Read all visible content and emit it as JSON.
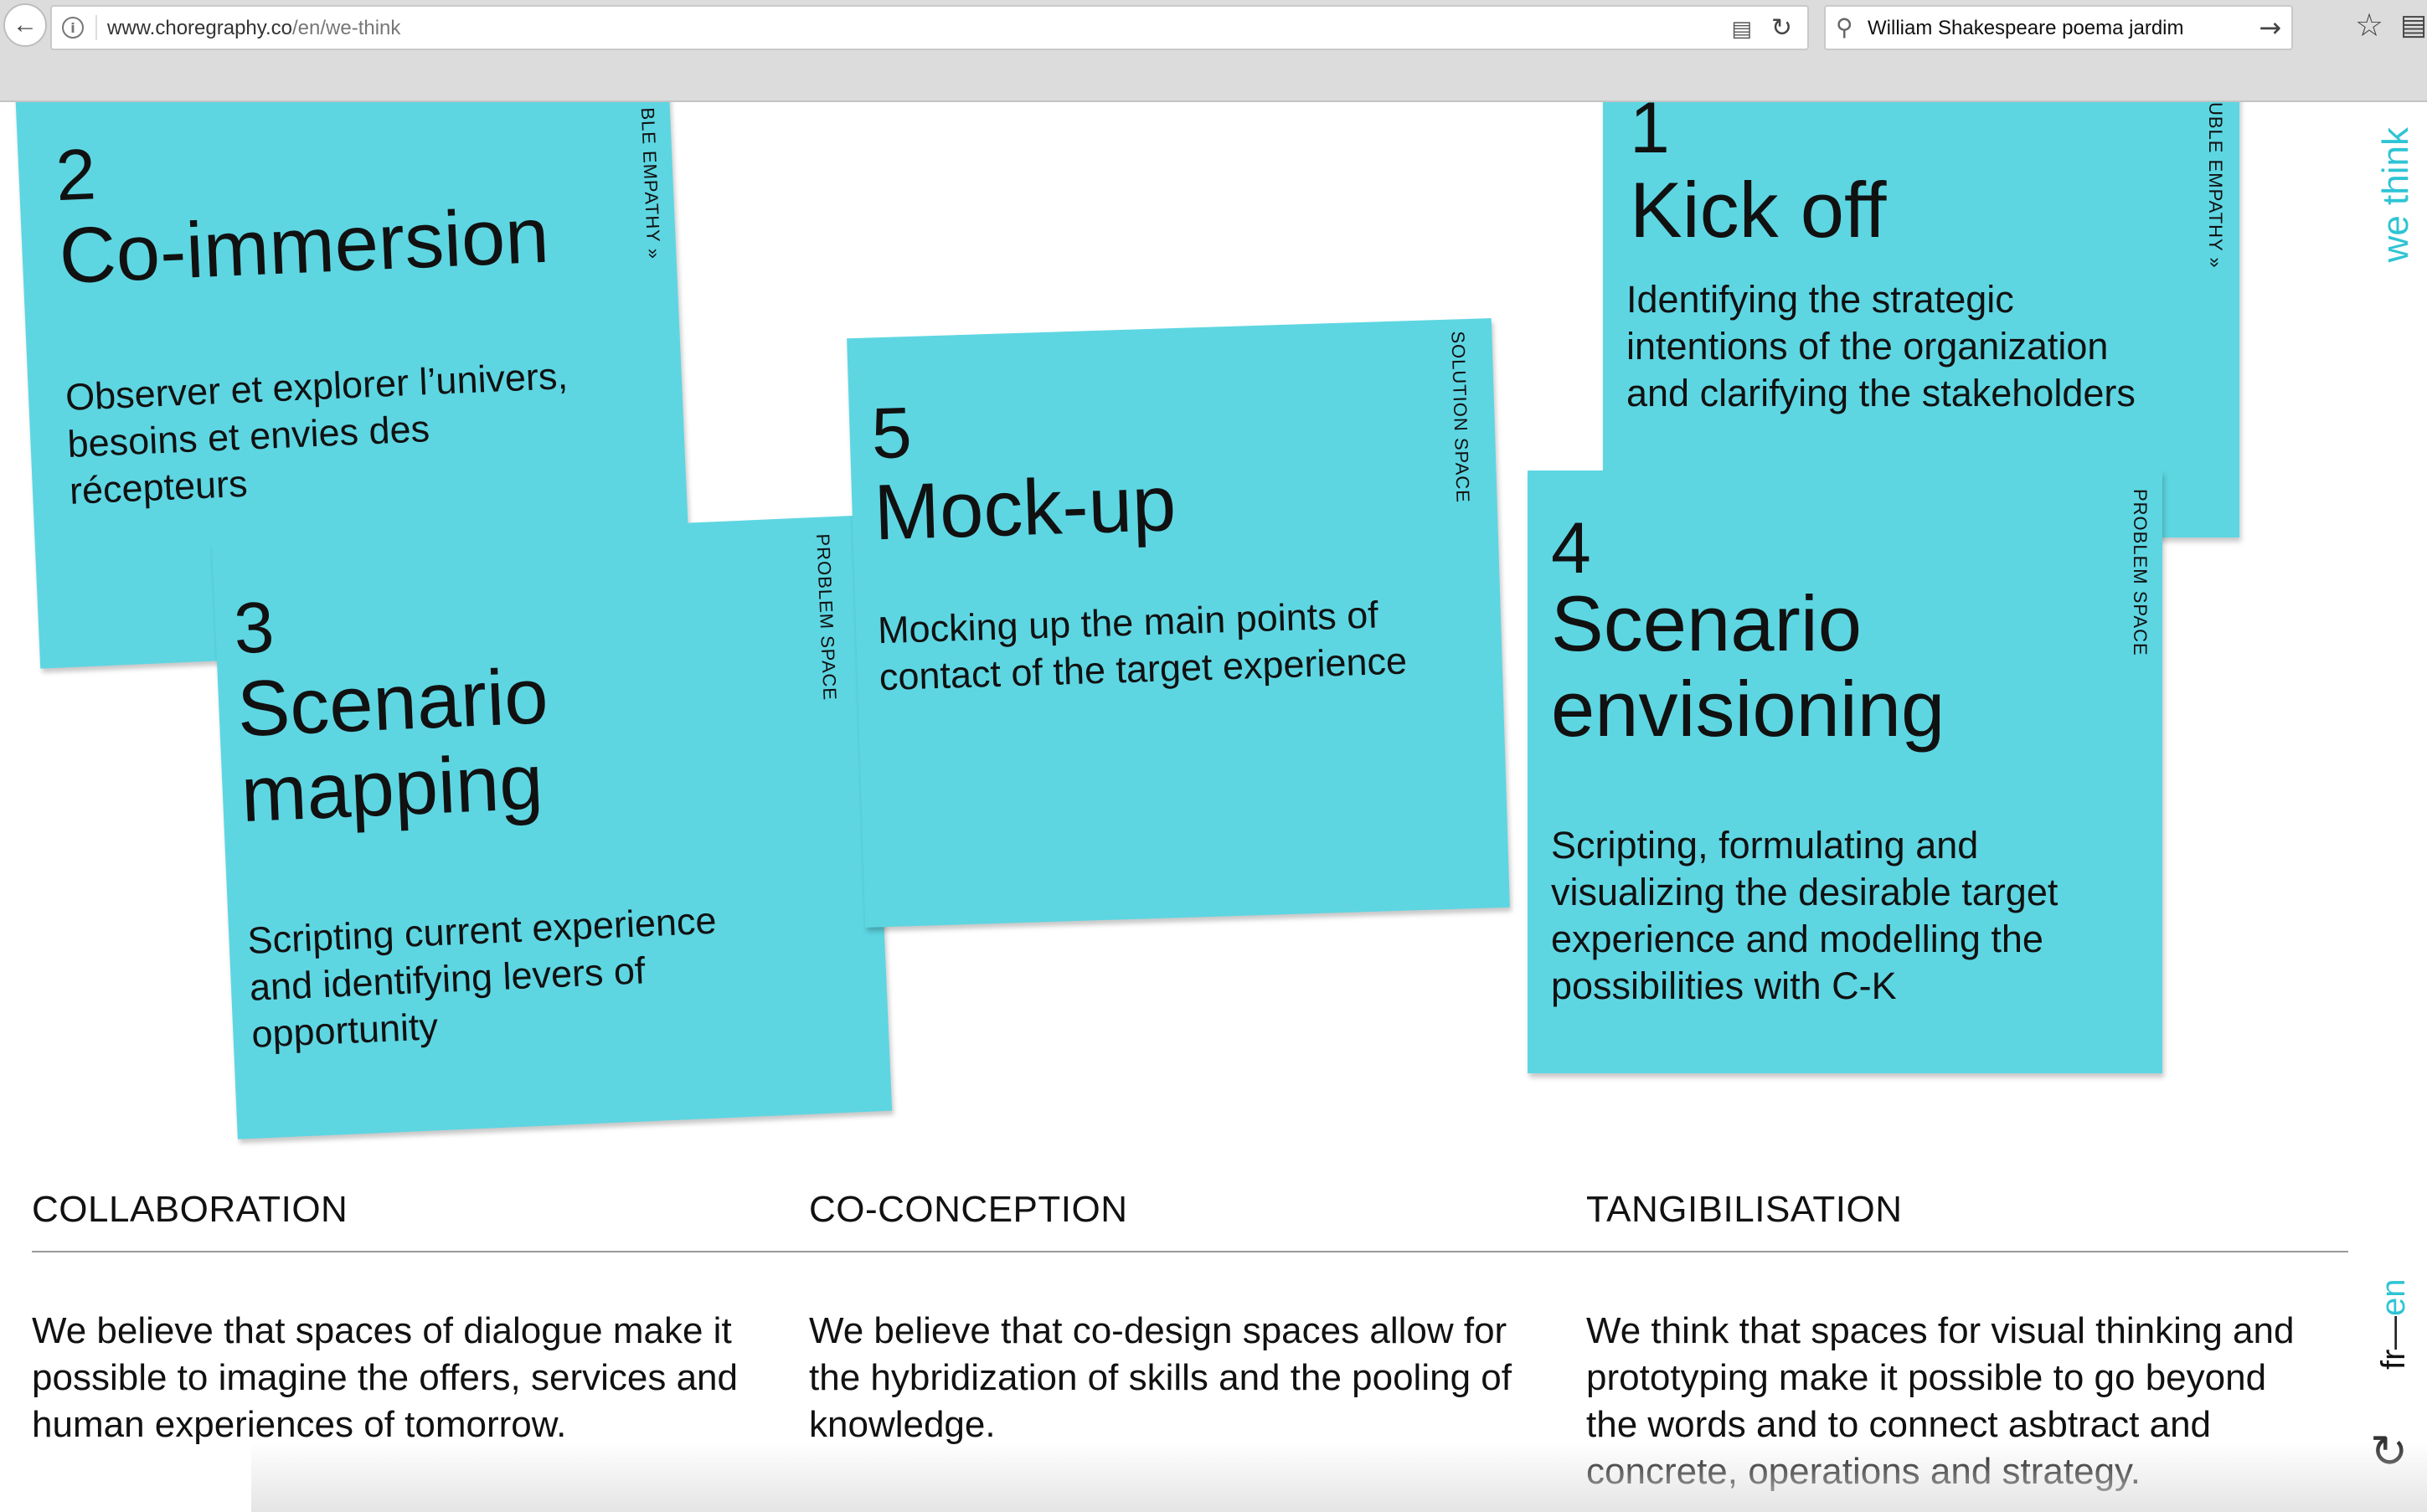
{
  "browser": {
    "url_domain": "www.choregraphy.co",
    "url_path": "/en/we-think",
    "search_query": "William Shakespeare poema jardim"
  },
  "icons": {
    "back": "back-arrow-icon",
    "info": "info-icon",
    "reader": "reader-view-icon",
    "reload": "reload-icon",
    "search": "search-icon",
    "go": "go-arrow-icon",
    "bookmark": "star-icon",
    "library": "library-icon",
    "scroll_top": "refresh-icon"
  },
  "accent_color": "#2ec4d4",
  "card_color": "#5dd6e2",
  "cards": [
    {
      "num": "2",
      "title": "Co-immersion",
      "desc": "Observer et explorer l’univers,\nbesoins et envies des\nrécepteurs",
      "label": "BLE EMPATHY »"
    },
    {
      "num": "3",
      "title": "Scenario\nmapping",
      "desc": "Scripting current experience\nand identifying levers of\nopportunity",
      "label": "PROBLEM SPACE"
    },
    {
      "num": "5",
      "title": "Mock-up",
      "desc": "Mocking up the main points of\ncontact of the target experience",
      "label": "SOLUTION SPACE"
    },
    {
      "num": "1",
      "title": "Kick off",
      "desc": "Identifying the strategic\nintentions of the organization\nand clarifying the stakeholders",
      "label": "UBLE EMPATHY »"
    },
    {
      "num": "4",
      "title": "Scenario\nenvisioning",
      "desc": "Scripting, formulating and\nvisualizing the desirable target\nexperience and modelling the\npossibilities with C-K",
      "label": "PROBLEM SPACE"
    }
  ],
  "columns": [
    {
      "heading": "COLLABORATION",
      "body": "We believe that spaces of dialogue make it\npossible to imagine the offers, services and\nhuman experiences of tomorrow."
    },
    {
      "heading": "CO-CONCEPTION",
      "body": "We believe that co-design spaces allow for\nthe hybridization of skills and the pooling of\nknowledge."
    },
    {
      "heading": "TANGIBILISATION",
      "body": "We think that spaces for visual thinking and\nprototyping make it possible to go beyond\nthe words and to connect asbtract and\nconcrete, operations and strategy."
    }
  ],
  "side": {
    "we_think": "we think",
    "lang_fr": "fr",
    "lang_sep": " — ",
    "lang_en": "en"
  }
}
